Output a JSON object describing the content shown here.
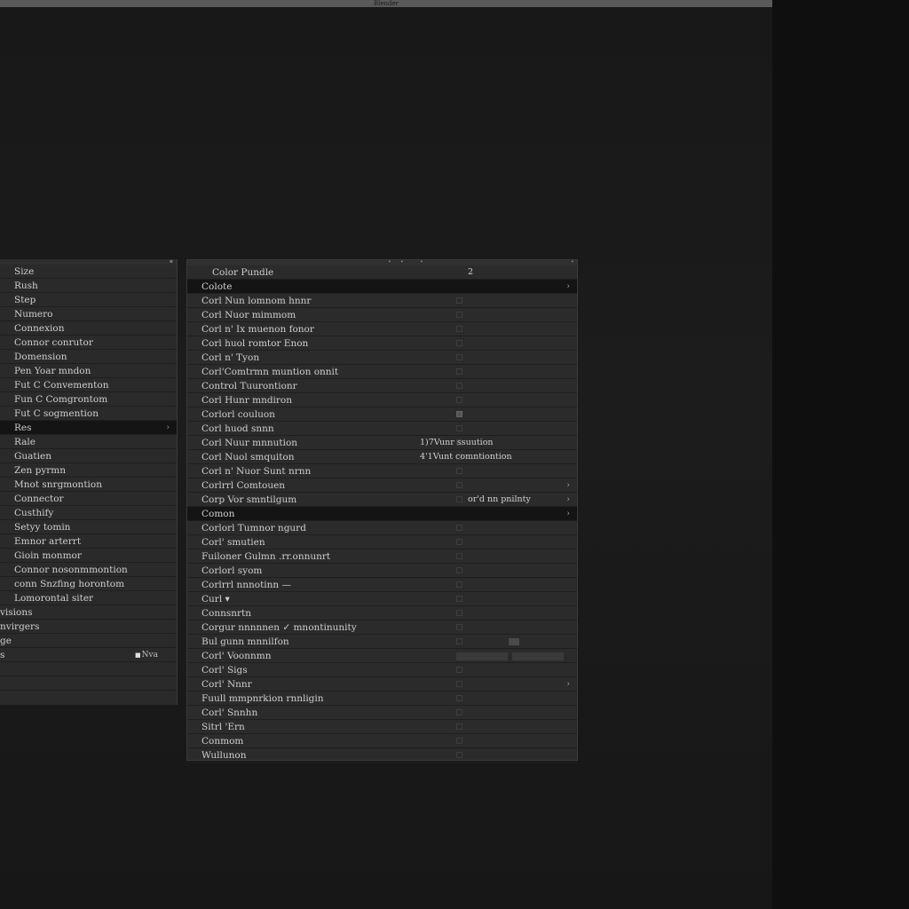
{
  "window": {
    "title": "Blender"
  },
  "left_menu": {
    "items": [
      {
        "label": "Size",
        "sub": false
      },
      {
        "label": "Rush",
        "sub": false
      },
      {
        "label": "Step",
        "sub": false
      },
      {
        "label": "Numero",
        "sub": false
      },
      {
        "label": "Connexion",
        "sub": false
      },
      {
        "label": "Connor conrutor",
        "sub": false
      },
      {
        "label": "Domension",
        "sub": false
      },
      {
        "label": "Pen Yoar mndon",
        "sub": false
      },
      {
        "label": "Fut C Convementon",
        "sub": false
      },
      {
        "label": "Fun C Comgrontom",
        "sub": false
      },
      {
        "label": "Fut C sogmention",
        "sub": false
      },
      {
        "label": "Res",
        "sub": false,
        "selected": true,
        "chevron": "›"
      },
      {
        "label": "Rale",
        "sub": false
      },
      {
        "label": "Guatien",
        "sub": false
      },
      {
        "label": "Zen pyrmn",
        "sub": false
      },
      {
        "label": "Mnot snrgmontion",
        "sub": false
      },
      {
        "label": "Connector",
        "sub": false
      },
      {
        "label": "Custhify",
        "sub": false
      },
      {
        "label": "Setyy tomin",
        "sub": false
      },
      {
        "label": "Emnor arterrt",
        "sub": false
      },
      {
        "label": "Gioin monmor",
        "sub": false
      },
      {
        "label": "Connor nosonmmontion",
        "sub": false
      },
      {
        "label": "conn Snzfing horontom",
        "sub": false
      },
      {
        "label": "Lomorontal siter",
        "sub": false
      },
      {
        "label": "visions",
        "sub": true
      },
      {
        "label": "nvirgers",
        "sub": true
      },
      {
        "label": "ge",
        "sub": true
      },
      {
        "label": "s",
        "sub": true,
        "side_label": "Nva"
      },
      {
        "label": "",
        "sub": true
      },
      {
        "label": "",
        "sub": true
      }
    ]
  },
  "right_menu": {
    "items": [
      {
        "label": "Color Pundle",
        "header": true,
        "shortcut": "2",
        "shortcut_right": true
      },
      {
        "label": "Colote",
        "selected": true,
        "chevron": "›"
      },
      {
        "label": "Corl Nun lomnom hnnr"
      },
      {
        "label": "Corl Nuor mimmom"
      },
      {
        "label": "Corl n' Ix muenon fonor"
      },
      {
        "label": "Corl huol romtor Enon"
      },
      {
        "label": "Corl n' Tyon"
      },
      {
        "label": "Corl'Comtrmn muntion onnit"
      },
      {
        "label": "Control Tuurontionr"
      },
      {
        "label": "Corl Hunr mndiron"
      },
      {
        "label": "Corlorl couluon",
        "mark_on": true
      },
      {
        "label": "Corl huod snnn"
      },
      {
        "label": "Corl Nuur mnnution",
        "shortcut": "1)7Vunr ssuution"
      },
      {
        "label": "Corl Nuol smquiton",
        "shortcut": "4'1Vunt comntiontion"
      },
      {
        "label": "Corl n' Nuor Sunt nrnn"
      },
      {
        "label": "Corlrrl Comtouen",
        "chevron": "›"
      },
      {
        "label": "Corp Vor smntilgum",
        "shortcut": "or'd nn pnilnty",
        "shortcut_right": true,
        "chevron": "›"
      },
      {
        "label": "Comon",
        "selected": true,
        "chevron": "›"
      },
      {
        "label": "Corlorl Tumnor ngurd"
      },
      {
        "label": "Corl' smutien"
      },
      {
        "label": "Fuiloner Gulmn .rr.onnunrt"
      },
      {
        "label": "Corlorl syom"
      },
      {
        "label": "Corlrrl nnnotinn —"
      },
      {
        "label": "Curl ▾"
      },
      {
        "label": "Connsnrtn"
      },
      {
        "label": "Corgur nnnnnen ✓ mnontinunity"
      },
      {
        "label": "Bul gunn mnnilfon",
        "swatch": true
      },
      {
        "label": "Corl' Voonnmn",
        "bars": true
      },
      {
        "label": "Corl' Sigs"
      },
      {
        "label": "Corl' Nnnr",
        "chevron": "›"
      },
      {
        "label": "Fuull mmpnrkion rnnligin"
      },
      {
        "label": "Corl' Snnhn"
      },
      {
        "label": "Sitrl 'Ern"
      },
      {
        "label": "Conmom"
      },
      {
        "label": "Wullunon"
      }
    ]
  }
}
